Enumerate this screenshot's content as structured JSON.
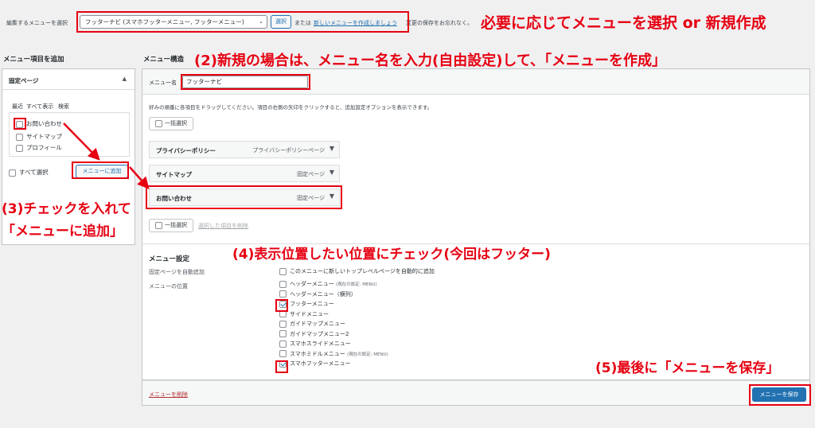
{
  "topbar": {
    "select_label": "編集するメニューを選択",
    "selected_menu": "フッターナビ (スマホフッターメニュー, フッターメニュー)",
    "select_button": "選択",
    "or_text": "または",
    "new_menu_link": "新しいメニューを作成しましょう",
    "save_reminder": "変更の保存をお忘れなく。"
  },
  "left": {
    "heading": "メニュー項目を追加",
    "section_title": "固定ページ",
    "tabs": [
      "最近",
      "すべて表示",
      "検索"
    ],
    "pages": [
      "お問い合わせ",
      "サイトマップ",
      "プロフィール"
    ],
    "select_all": "すべて選択",
    "add_button": "メニューに追加"
  },
  "structure": {
    "heading": "メニュー構造",
    "name_label": "メニュー名",
    "name_value": "フッターナビ",
    "instructions": "好みの順番に各項目をドラッグしてください。項目の右側の矢印をクリックすると、追加設定オプションを表示できます。",
    "bulk_select": "一括選択",
    "items": [
      {
        "title": "プライバシーポリシー",
        "type": "プライバシーポリシーページ"
      },
      {
        "title": "サイトマップ",
        "type": "固定ページ"
      },
      {
        "title": "お問い合わせ",
        "type": "固定ページ"
      }
    ],
    "remove_selected": "選択した項目を削除"
  },
  "settings": {
    "heading": "メニュー設定",
    "auto_add_label": "固定ページを自動追加",
    "auto_add_option": "このメニューに新しいトップレベルページを自動的に追加",
    "location_label": "メニューの位置",
    "locations": [
      {
        "name": "ヘッダーメニュー",
        "note": "(現在の設定: MENU)",
        "checked": false
      },
      {
        "name": "ヘッダーメニュー（横列）",
        "note": "",
        "checked": false
      },
      {
        "name": "フッターメニュー",
        "note": "",
        "checked": true
      },
      {
        "name": "サイドメニュー",
        "note": "",
        "checked": false
      },
      {
        "name": "ガイドマップメニュー",
        "note": "",
        "checked": false
      },
      {
        "name": "ガイドマップメニュー2",
        "note": "",
        "checked": false
      },
      {
        "name": "スマホスライドメニュー",
        "note": "",
        "checked": false
      },
      {
        "name": "スマホミドルメニュー",
        "note": "(現在の設定: MENU)",
        "checked": false
      },
      {
        "name": "スマホフッターメニュー",
        "note": "",
        "checked": true
      }
    ]
  },
  "footer": {
    "delete_link": "メニューを削除",
    "save_button": "メニューを保存"
  },
  "annotations": {
    "a1": "必要に応じてメニューを選択 or 新規作成",
    "a2": "(2)新規の場合は、メニュー名を入力(自由設定)して、「メニューを作成」",
    "a3_line1": "(3)チェックを入れて",
    "a3_line2": "「メニューに追加」",
    "a4": "(4)表示位置したい位置にチェック(今回はフッター)",
    "a5": "(5)最後に「メニューを保存」"
  },
  "colors": {
    "annotation_red": "#e60012",
    "wp_blue": "#2271b1",
    "background": "#f0f0f1"
  }
}
